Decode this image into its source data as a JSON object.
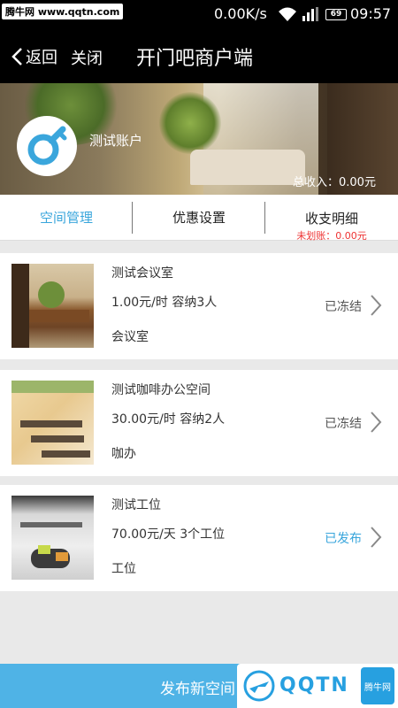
{
  "watermark": {
    "top_text": "腾牛网 www.qqtn.com",
    "logo_text": "QQTN",
    "badge_text": "腾牛网"
  },
  "statusbar": {
    "speed": "0.00K/s",
    "battery": "69",
    "time": "09:57"
  },
  "navbar": {
    "back_label": "返回",
    "close_label": "关闭",
    "title": "开门吧商户端"
  },
  "account": {
    "name": "测试账户",
    "total_income": "总收入：0.00元"
  },
  "tabs": {
    "space_management": "空间管理",
    "discount_settings": "优惠设置",
    "income_details": "收支明细",
    "unsettled": "未划账：0.00元"
  },
  "spaces": [
    {
      "name": "测试会议室",
      "price": "1.00元/时  容纳3人",
      "type": "会议室",
      "status": "已冻结"
    },
    {
      "name": "测试咖啡办公空间",
      "price": "30.00元/时  容纳2人",
      "type": "咖办",
      "status": "已冻结"
    },
    {
      "name": "测试工位",
      "price": "70.00元/天  3个工位",
      "type": "工位",
      "status": "已发布"
    }
  ],
  "publish_button": "发布新空间",
  "colors": {
    "accent": "#3aa6dc",
    "warning": "#e33333",
    "bar": "#4fb3e6"
  }
}
